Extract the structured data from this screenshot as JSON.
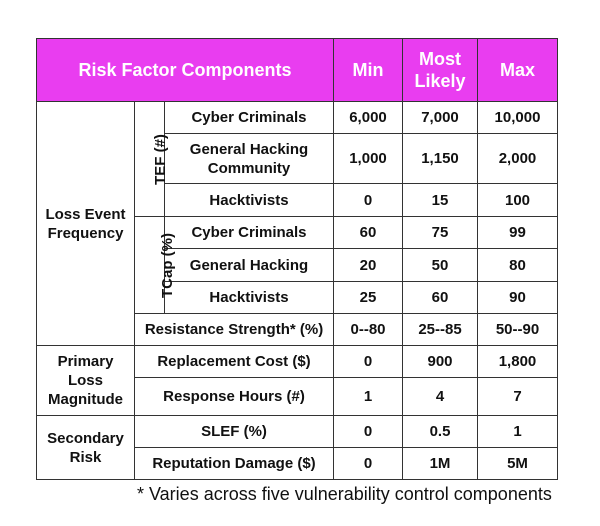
{
  "header": {
    "component": "Risk Factor Components",
    "min": "Min",
    "most_likely": "Most Likely",
    "max": "Max"
  },
  "groups": {
    "lef": "Loss Event Frequency",
    "tef": "TEF (#)",
    "tcap": "TCap (%)",
    "plm": "Primary Loss Magnitude",
    "sr": "Secondary Risk"
  },
  "rows": [
    {
      "label": "Cyber Criminals",
      "min": "6,000",
      "likely": "7,000",
      "max": "10,000"
    },
    {
      "label": "General Hacking Community",
      "min": "1,000",
      "likely": "1,150",
      "max": "2,000"
    },
    {
      "label": "Hacktivists",
      "min": "0",
      "likely": "15",
      "max": "100"
    },
    {
      "label": "Cyber Criminals",
      "min": "60",
      "likely": "75",
      "max": "99"
    },
    {
      "label": "General Hacking",
      "min": "20",
      "likely": "50",
      "max": "80"
    },
    {
      "label": "Hacktivists",
      "min": "25",
      "likely": "60",
      "max": "90"
    },
    {
      "label": "Resistance Strength* (%)",
      "min": "0--80",
      "likely": "25--85",
      "max": "50--90"
    },
    {
      "label": "Replacement Cost ($)",
      "min": "0",
      "likely": "900",
      "max": "1,800"
    },
    {
      "label": "Response Hours (#)",
      "min": "1",
      "likely": "4",
      "max": "7"
    },
    {
      "label": "SLEF (%)",
      "min": "0",
      "likely": "0.5",
      "max": "1"
    },
    {
      "label": "Reputation Damage ($)",
      "min": "0",
      "likely": "1M",
      "max": "5M"
    }
  ],
  "footnote": "* Varies across five vulnerability control components",
  "colors": {
    "header_bg": "#E93DF0",
    "header_text": "#FFFFFF"
  }
}
